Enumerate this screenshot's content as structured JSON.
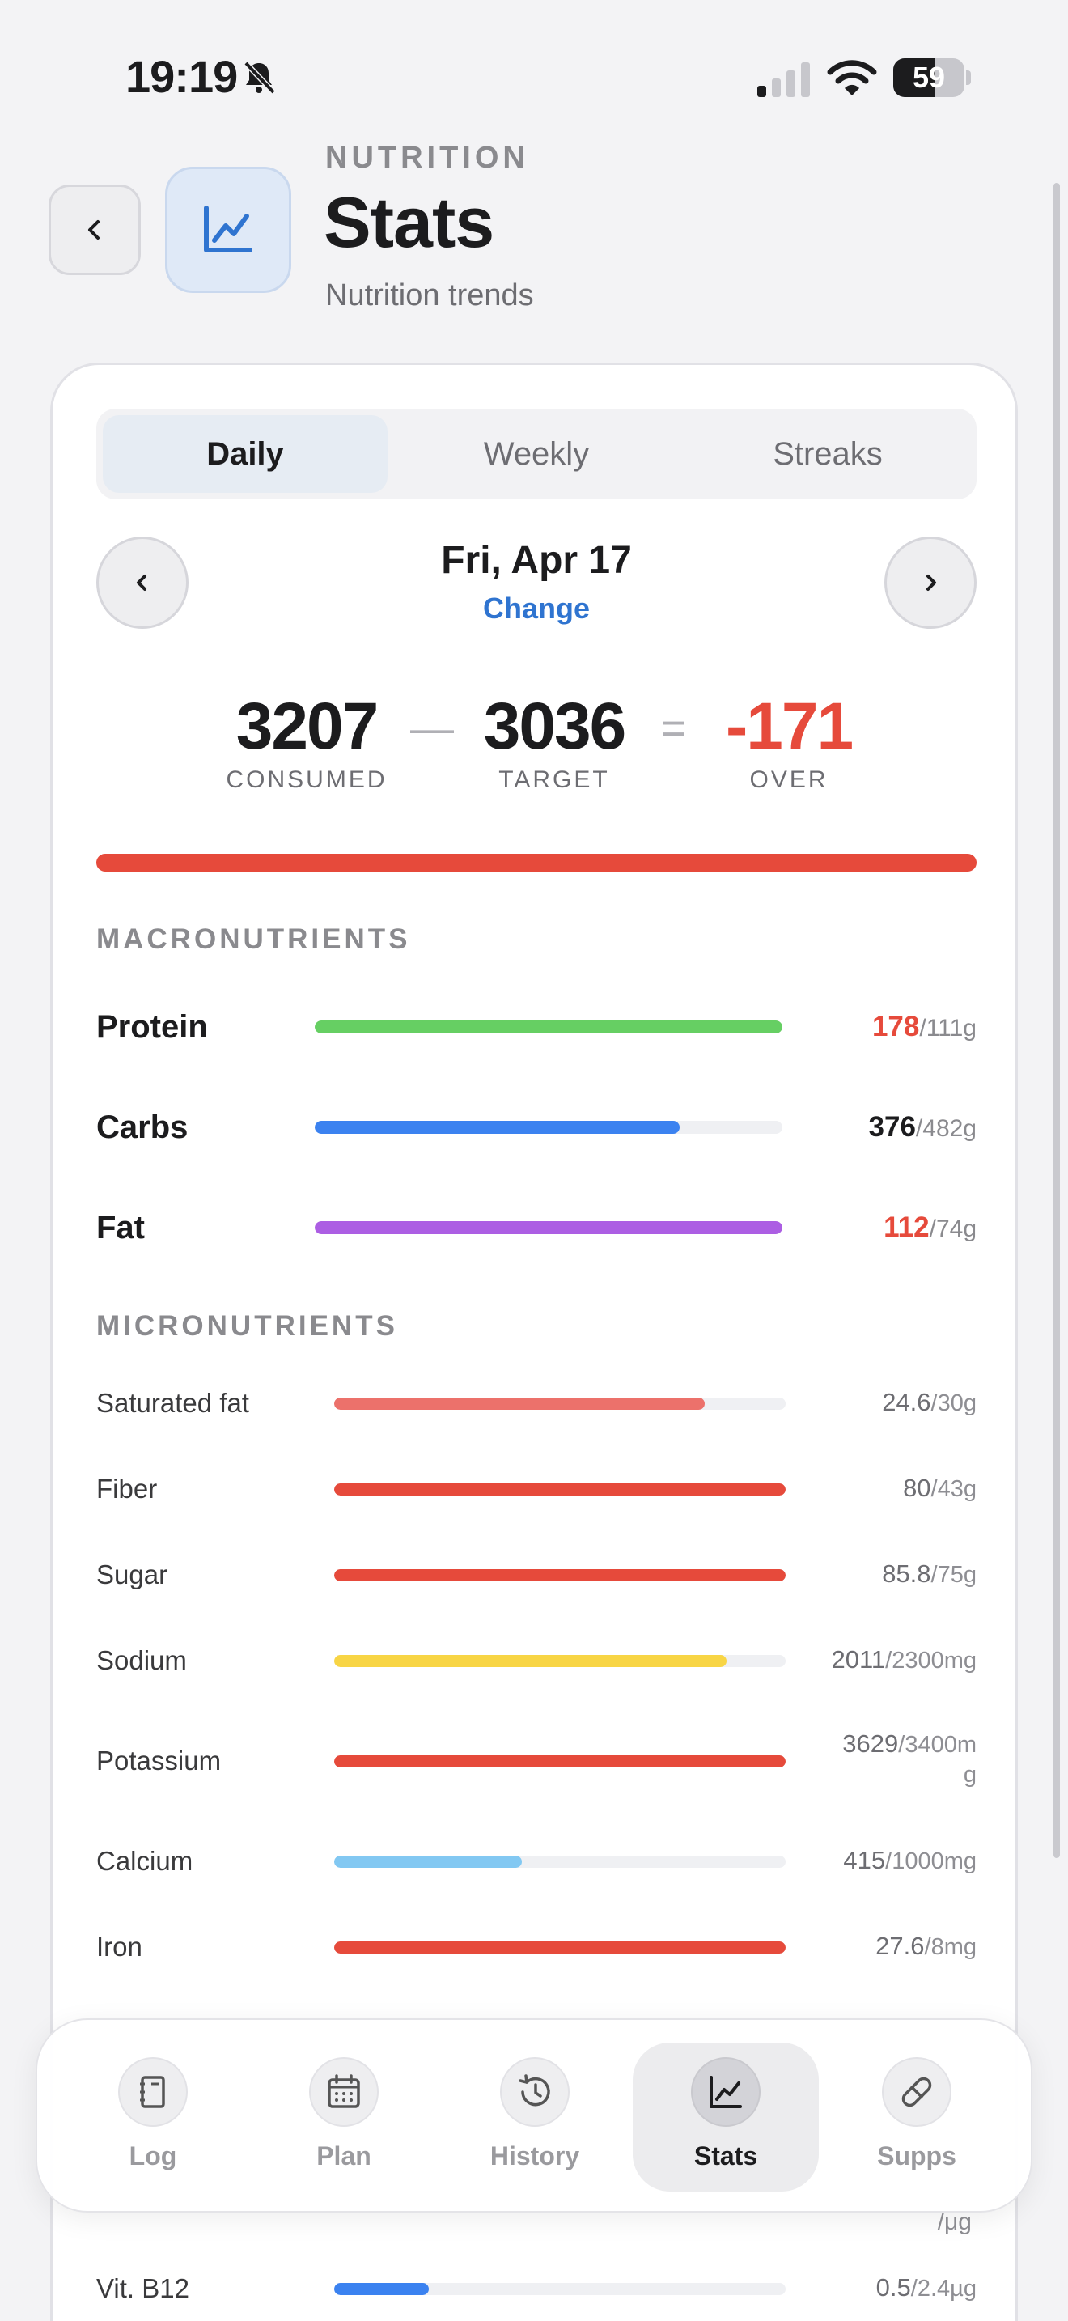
{
  "status_bar": {
    "time": "19:19",
    "battery_level": "59",
    "battery_fraction": 0.59,
    "icons": [
      "bell-slash-icon",
      "signal-icon",
      "wifi-icon",
      "battery-icon"
    ]
  },
  "header": {
    "eyebrow": "NUTRITION",
    "title": "Stats",
    "subtitle": "Nutrition trends",
    "icon": "chart-line-icon",
    "back_icon": "chevron-left-icon"
  },
  "segments": [
    {
      "label": "Daily",
      "active": true
    },
    {
      "label": "Weekly",
      "active": false
    },
    {
      "label": "Streaks",
      "active": false
    }
  ],
  "date_nav": {
    "date": "Fri, Apr 17",
    "change_label": "Change",
    "prev_icon": "chevron-left-icon",
    "next_icon": "chevron-right-icon"
  },
  "summary": {
    "consumed": "3207",
    "consumed_label": "CONSUMED",
    "minus": "—",
    "target": "3036",
    "target_label": "TARGET",
    "equals": "=",
    "balance": "-171",
    "balance_label": "OVER",
    "progress_fraction": 1.0
  },
  "colors": {
    "over": "#e64a3b",
    "protein": "#66cf63",
    "carbs": "#3b82f0",
    "fat": "#ac5ee3",
    "saturated_fat": "#ec716b",
    "sodium": "#f8d545",
    "calcium": "#82c8f2",
    "b12": "#3b82f0",
    "accent": "#2f74d0"
  },
  "macros": {
    "title": "MACRONUTRIENTS",
    "items": [
      {
        "name": "Protein",
        "value": "178",
        "target": "/111g",
        "fraction": 1.0,
        "over": true
      },
      {
        "name": "Carbs",
        "value": "376",
        "target": "/482g",
        "fraction": 0.78,
        "over": false
      },
      {
        "name": "Fat",
        "value": "112",
        "target": "/74g",
        "fraction": 1.0,
        "over": true
      }
    ]
  },
  "micros": {
    "title": "MICRONUTRIENTS",
    "items": [
      {
        "name": "Saturated fat",
        "value": "24.6",
        "target": "/30g",
        "fraction": 0.82
      },
      {
        "name": "Fiber",
        "value": "80",
        "target": "/43g",
        "fraction": 1.0
      },
      {
        "name": "Sugar",
        "value": "85.8",
        "target": "/75g",
        "fraction": 1.0
      },
      {
        "name": "Sodium",
        "value": "2011",
        "target": "/2300mg",
        "fraction": 0.87
      },
      {
        "name": "Potassium",
        "value": "3629",
        "target": "/3400m",
        "target_wrap": "g",
        "fraction": 1.0
      },
      {
        "name": "Calcium",
        "value": "415",
        "target": "/1000mg",
        "fraction": 0.415
      },
      {
        "name": "Iron",
        "value": "27.6",
        "target": "/8mg",
        "fraction": 1.0
      },
      {
        "name": "Vit. B12",
        "value": "0.5",
        "target": "/2.4µg",
        "fraction": 0.21
      }
    ],
    "partial_hidden_value": "/μg"
  },
  "tab_bar": {
    "items": [
      {
        "label": "Log",
        "icon": "notebook-icon",
        "active": false
      },
      {
        "label": "Plan",
        "icon": "calendar-icon",
        "active": false
      },
      {
        "label": "History",
        "icon": "history-icon",
        "active": false
      },
      {
        "label": "Stats",
        "icon": "chart-line-icon",
        "active": true
      },
      {
        "label": "Supps",
        "icon": "pill-icon",
        "active": false
      }
    ]
  }
}
